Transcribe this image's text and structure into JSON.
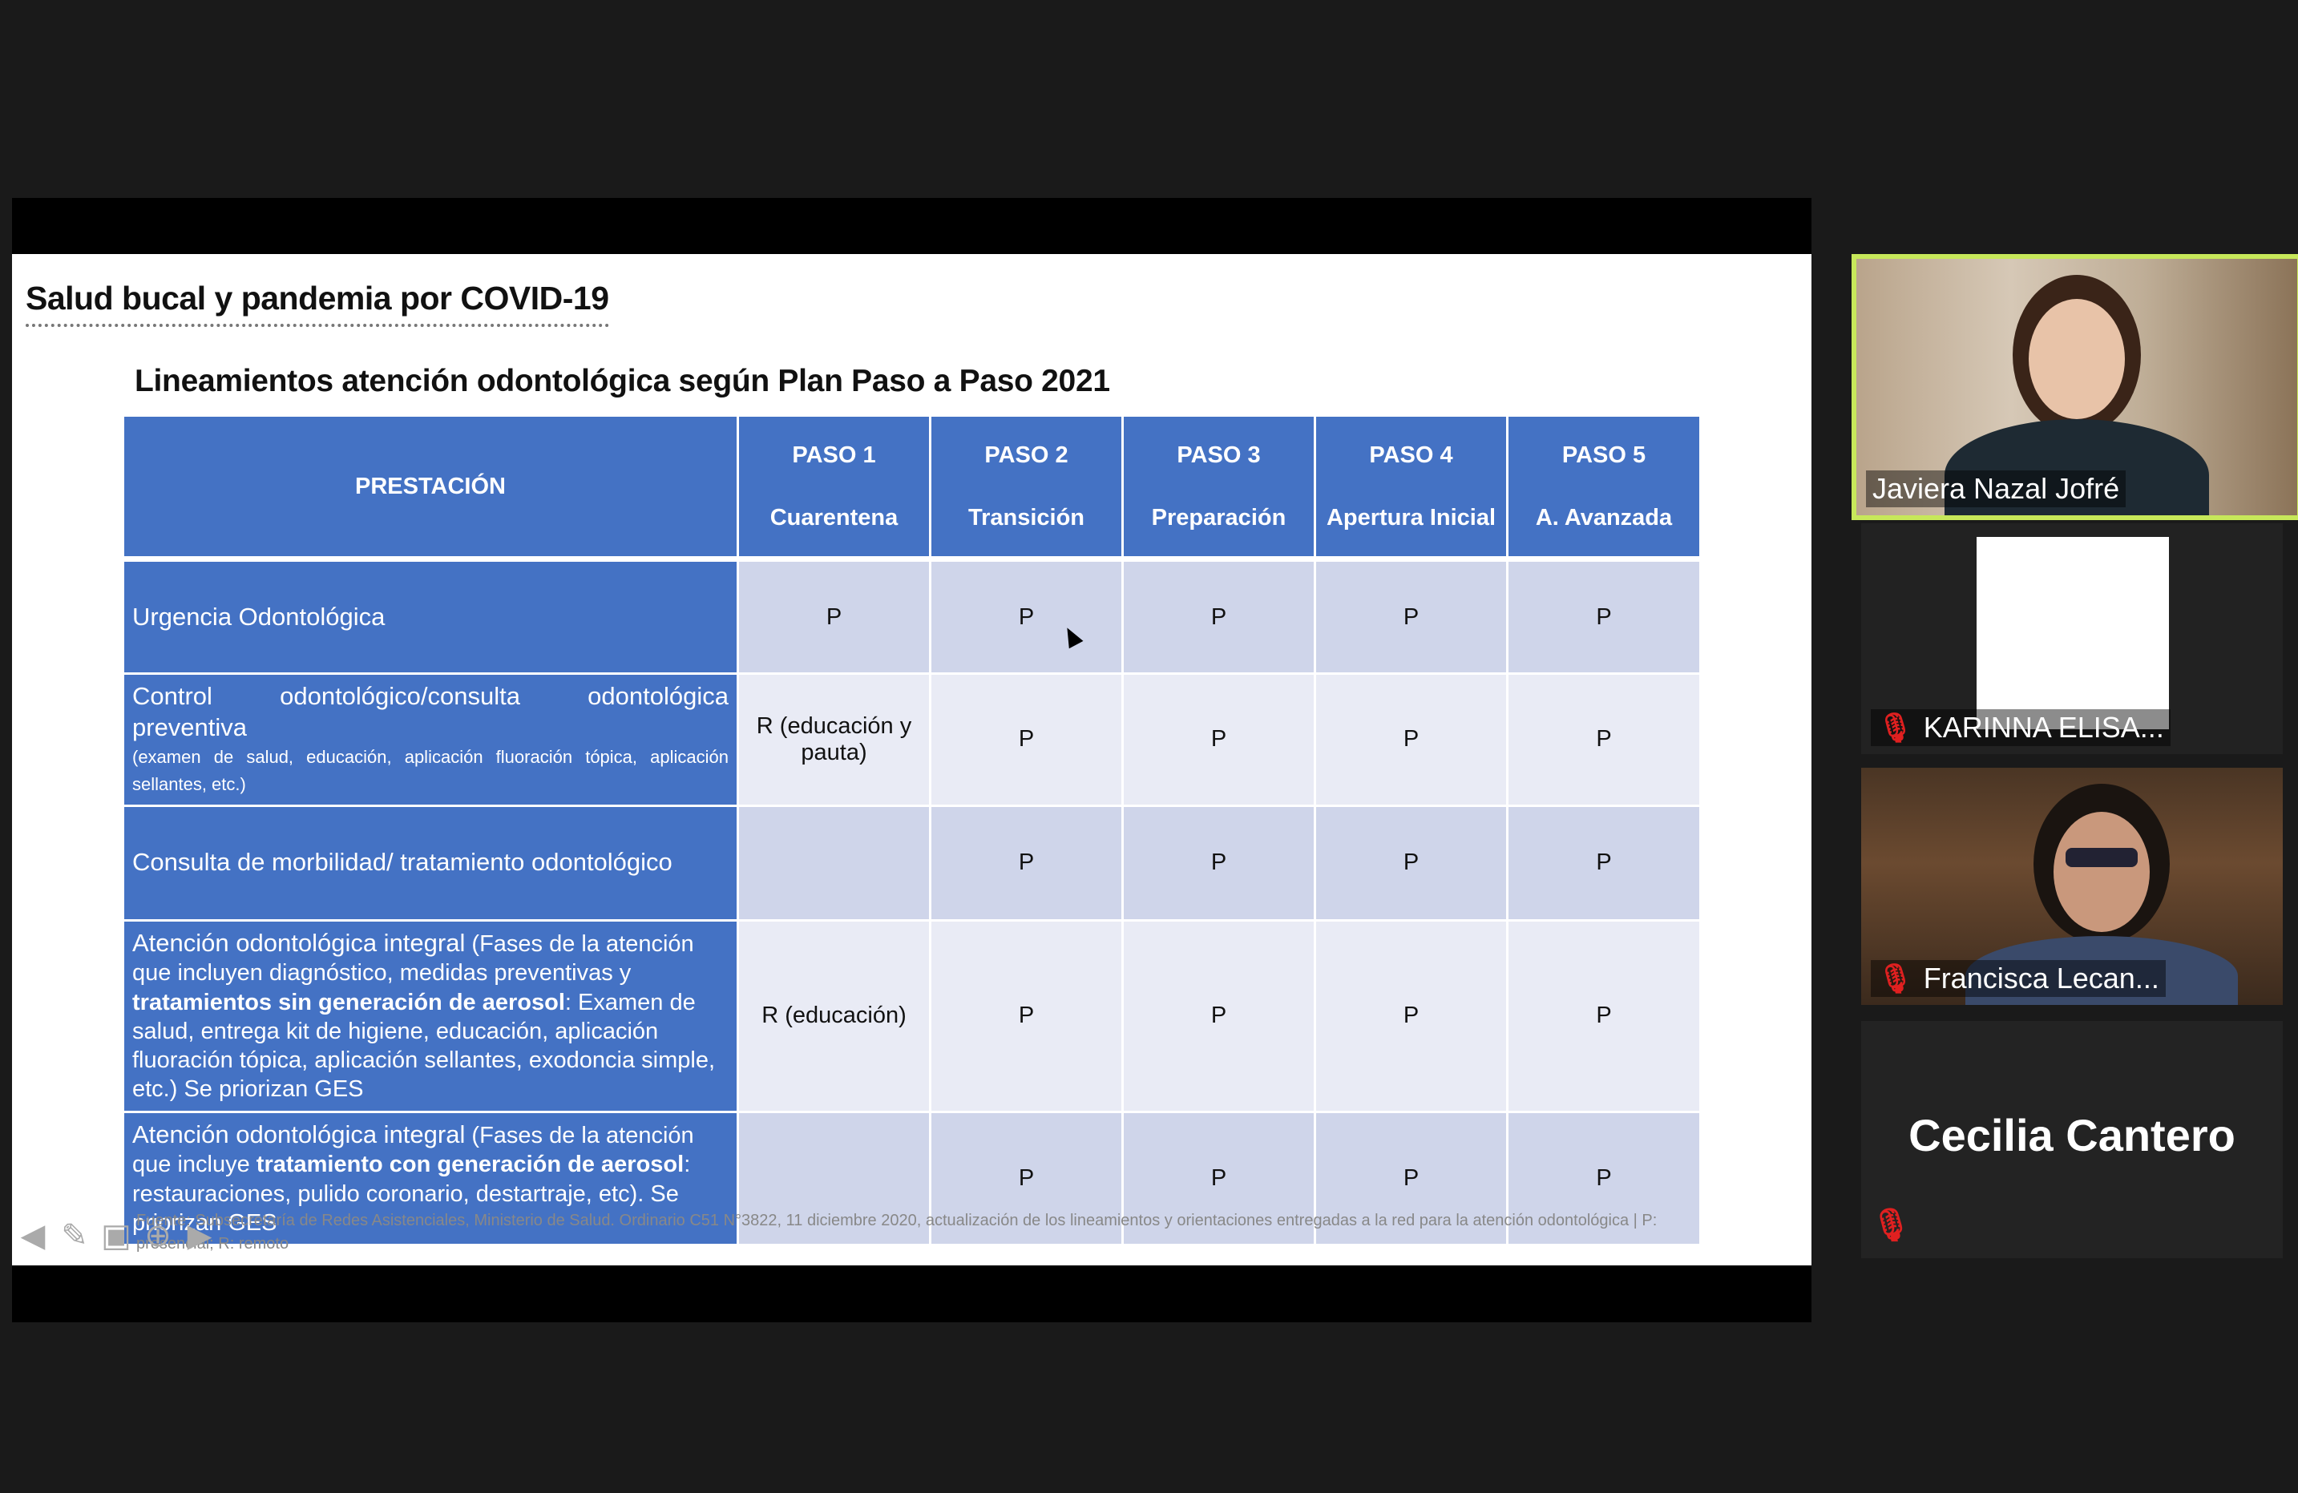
{
  "slide": {
    "title": "Salud bucal y pandemia por COVID-19",
    "table_title": "Lineamientos atención odontológica según Plan Paso a Paso 2021",
    "header": {
      "prestacion": "PRESTACIÓN",
      "pasos": [
        {
          "paso": "PASO 1",
          "fase": "Cuarentena"
        },
        {
          "paso": "PASO 2",
          "fase": "Transición"
        },
        {
          "paso": "PASO 3",
          "fase": "Preparación"
        },
        {
          "paso": "PASO 4",
          "fase": "Apertura Inicial"
        },
        {
          "paso": "PASO 5",
          "fase": "A. Avanzada"
        }
      ]
    },
    "rows": [
      {
        "main": "Urgencia Odontológica",
        "sub_pre": "",
        "sub_bold": "",
        "sub_mid": "",
        "sub_bold2": "",
        "sub_post": "",
        "cells": [
          "P",
          "P",
          "P",
          "P",
          "P"
        ]
      },
      {
        "main": "Control odontológico/consulta odontológica preventiva",
        "sub_pre": "(examen de salud, educación, aplicación fluoración tópica, aplicación sellantes, etc.)",
        "sub_bold": "",
        "sub_mid": "",
        "sub_bold2": "",
        "sub_post": "",
        "cells": [
          "R (educación y pauta)",
          "P",
          "P",
          "P",
          "P"
        ]
      },
      {
        "main": "Consulta de morbilidad/ tratamiento odontológico",
        "sub_pre": "",
        "sub_bold": "",
        "sub_mid": "",
        "sub_bold2": "",
        "sub_post": "",
        "cells": [
          "",
          "P",
          "P",
          "P",
          "P"
        ]
      },
      {
        "main": "Atención odontológica integral",
        "sub_pre": " (Fases de la atención que incluyen diagnóstico, medidas preventivas y ",
        "sub_bold": "tratamientos sin generación de aerosol",
        "sub_mid": ": Examen de salud, entrega kit de higiene, educación, aplicación fluoración tópica, aplicación sellantes, exodoncia simple, etc.) Se priorizan GES",
        "sub_bold2": "",
        "sub_post": "",
        "cells": [
          "R (educación)",
          "P",
          "P",
          "P",
          "P"
        ]
      },
      {
        "main": "Atención odontológica integral",
        "sub_pre": " (Fases de la atención que incluye ",
        "sub_bold": "tratamiento con generación de aerosol",
        "sub_mid": ": restauraciones, pulido coronario, destartraje, etc). Se priorizan GES",
        "sub_bold2": "",
        "sub_post": "",
        "cells": [
          "",
          "P",
          "P",
          "P",
          "P"
        ]
      }
    ],
    "source": "Fuente: Subsecretaría de Redes Asistenciales, Ministerio de Salud. Ordinario C51 N°3822, 11 diciembre 2020, actualización de los lineamientos y orientaciones entregadas a la red para la atención odontológica | P: presencial; R: remoto"
  },
  "participants": [
    {
      "name": "Javiera Nazal Jofré",
      "active_speaker": true,
      "muted": false
    },
    {
      "name": "KARINNA ELISA...",
      "muted": true
    },
    {
      "name": "Francisca Lecan...",
      "muted": true
    },
    {
      "name": "Cecilia Cantero",
      "muted": true
    }
  ],
  "colors": {
    "header_blue": "#4472c4",
    "row_odd": "#cfd5ea",
    "row_even": "#e9ebf5",
    "remote_red": "#e00000",
    "speaker_border": "#c7e85a"
  },
  "icons": [
    "prev-slide-icon",
    "pen-icon",
    "slides-icon",
    "zoom-icon",
    "next-slide-icon",
    "mic-muted-icon"
  ]
}
